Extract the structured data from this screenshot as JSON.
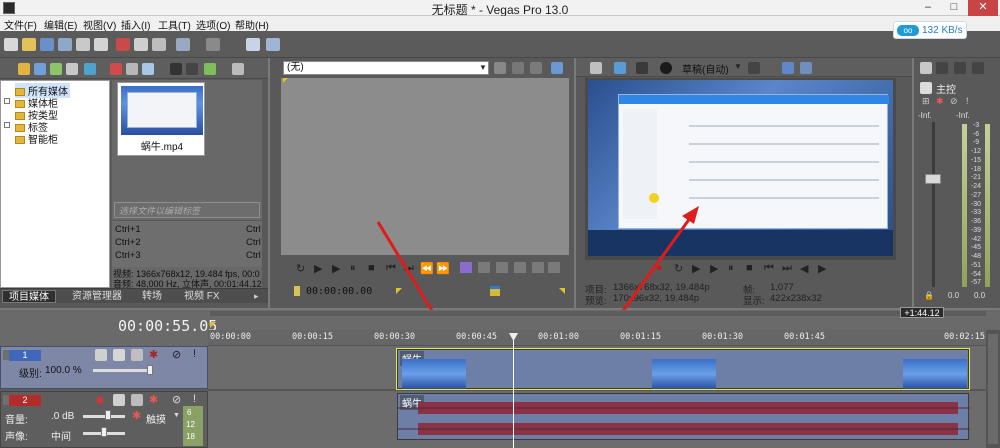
{
  "window": {
    "title": "无标题 * - Vegas Pro 13.0",
    "minimize": "–",
    "maximize": "□",
    "close": "✕"
  },
  "menu": [
    "文件(F)",
    "编辑(E)",
    "视图(V)",
    "插入(I)",
    "工具(T)",
    "选项(O)",
    "帮助(H)"
  ],
  "network": {
    "speed": "132 KB/s",
    "icon": "oo"
  },
  "explorer": {
    "tree": [
      "所有媒体",
      "媒体柜",
      "按类型",
      "标签",
      "智能柜"
    ],
    "media": {
      "name": "蜗牛.mp4"
    },
    "tag_placeholder": "选择文件以编辑标签",
    "hotkeys": [
      {
        "key": "Ctrl+1",
        "right": "Ctrl"
      },
      {
        "key": "Ctrl+2",
        "right": "Ctrl"
      },
      {
        "key": "Ctrl+3",
        "right": "Ctrl"
      }
    ],
    "info_video": "视频: 1366x768x12, 19.484 fps, 00:0",
    "info_audio": "音频: 48,000 Hz, 立体声, 00:01:44.12",
    "tabs": [
      "项目媒体",
      "资源管理器",
      "转场",
      "视频 FX"
    ]
  },
  "trimmer": {
    "selection": "(无)",
    "timecode": "00:00:00.00"
  },
  "preview": {
    "quality": "草稿(自动)",
    "project_label": "项目:",
    "project_value": "1366x768x32, 19.484p",
    "preview_label": "预览:",
    "preview_value": "170x96x32, 19.484p",
    "frame_label": "帧:",
    "frame_value": "1,077",
    "display_label": "显示:",
    "display_value": "422x238x32"
  },
  "mixer": {
    "title": "主控",
    "top_left": "-Inf.",
    "top_right": "-Inf.",
    "scale": [
      "3",
      "6",
      "9",
      "12",
      "15",
      "18",
      "21",
      "24",
      "27",
      "30",
      "33",
      "36",
      "39",
      "42",
      "45",
      "48",
      "51",
      "54",
      "57"
    ],
    "bottom_left": "0.0",
    "bottom_right": "0.0"
  },
  "timeline": {
    "time": "00:00:55.05",
    "cursor_time": "+1:44.12",
    "ruler": [
      "00:00:00",
      "00:00:15",
      "00:00:30",
      "00:00:45",
      "00:01:00",
      "00:01:15",
      "00:01:30",
      "00:01:45",
      "00:02:15"
    ],
    "video_track": {
      "number": "1",
      "level_label": "级别:",
      "level_value": "100.0 %"
    },
    "audio_track": {
      "number": "2",
      "volume_label": "音量:",
      "volume_value": ".0 dB",
      "pan_label": "声像:",
      "pan_value": "中间",
      "mode": "触摸",
      "meter": [
        "6",
        "12",
        "18"
      ]
    },
    "clip_name": "蜗牛"
  }
}
